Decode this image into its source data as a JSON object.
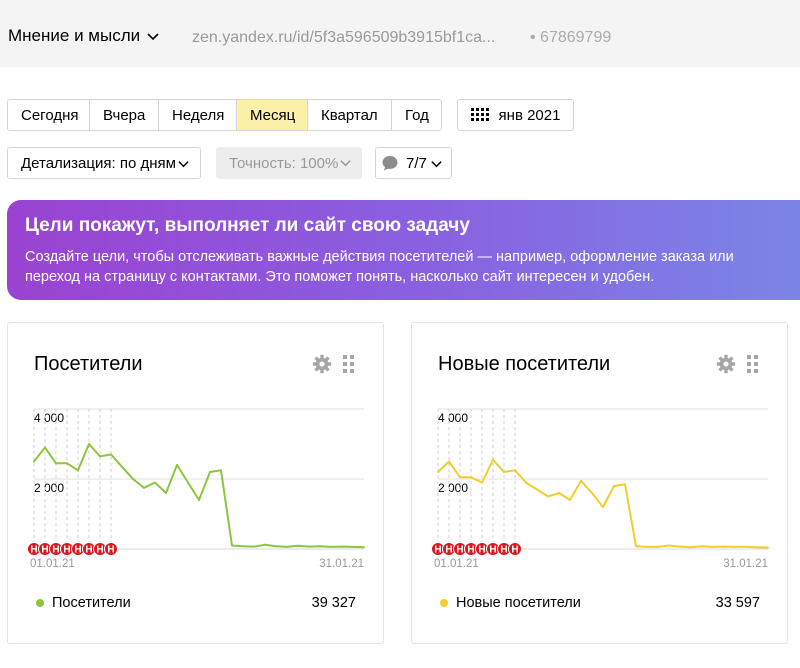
{
  "header": {
    "counter_name": "Мнение и мысли",
    "counter_url": "zen.yandex.ru/id/5f3a596509b3915bf1ca...",
    "counter_id": "• 67869799"
  },
  "periods": [
    {
      "label": "Сегодня",
      "active": false
    },
    {
      "label": "Вчера",
      "active": false
    },
    {
      "label": "Неделя",
      "active": false
    },
    {
      "label": "Месяц",
      "active": true
    },
    {
      "label": "Квартал",
      "active": false
    },
    {
      "label": "Год",
      "active": false
    }
  ],
  "datepicker": {
    "label": "янв 2021",
    "icon": "calendar-icon"
  },
  "controls": {
    "detail_label": "Детализация: по дням",
    "accuracy_label": "Точность: 100%",
    "notes_label": "7/7"
  },
  "banner": {
    "title": "Цели покажут, выполняет ли сайт свою задачу",
    "text": "Создайте цели, чтобы отслеживать важные действия посетителей — например, оформление заказа или переход на страницу с контактами. Это поможет понять, насколько сайт интересен и удобен."
  },
  "colors": {
    "active_period": "#fdf0a8",
    "banner_start": "#9a42d1",
    "banner_end": "#7a86e6",
    "visitors_series": "#8cc63f",
    "new_visitors_series": "#f2cd2e",
    "holiday_marker": "#d81820"
  },
  "widgets": [
    {
      "title": "Посетители",
      "legend_label": "Посетители",
      "total": "39 327",
      "color": "#8cc63f"
    },
    {
      "title": "Новые посетители",
      "legend_label": "Новые посетители",
      "total": "33 597",
      "color": "#f2cd2e"
    }
  ],
  "chart_data": [
    {
      "type": "line",
      "title": "Посетители",
      "x": [
        "01.01.21",
        "02.01.21",
        "03.01.21",
        "04.01.21",
        "05.01.21",
        "06.01.21",
        "07.01.21",
        "08.01.21",
        "09.01.21",
        "10.01.21",
        "11.01.21",
        "12.01.21",
        "13.01.21",
        "14.01.21",
        "15.01.21",
        "16.01.21",
        "17.01.21",
        "18.01.21",
        "19.01.21",
        "20.01.21",
        "21.01.21",
        "22.01.21",
        "23.01.21",
        "24.01.21",
        "25.01.21",
        "26.01.21",
        "27.01.21",
        "28.01.21",
        "29.01.21",
        "30.01.21",
        "31.01.21"
      ],
      "x_tick_labels": [
        "01.01.21",
        "31.01.21"
      ],
      "series": [
        {
          "name": "Посетители",
          "values": [
            2500,
            2900,
            2450,
            2450,
            2250,
            3000,
            2650,
            2700,
            2350,
            2000,
            1750,
            1900,
            1600,
            2400,
            1900,
            1400,
            2200,
            2250,
            100,
            80,
            70,
            120,
            80,
            60,
            90,
            70,
            80,
            60,
            70,
            60,
            50
          ]
        }
      ],
      "y_ticks": [
        2000,
        4000
      ],
      "y_tick_labels": [
        "2 000",
        "4 000"
      ],
      "ylim": [
        0,
        4000
      ],
      "holiday_label": "Н",
      "holidays": [
        "01.01.21",
        "02.01.21",
        "03.01.21",
        "04.01.21",
        "05.01.21",
        "06.01.21",
        "07.01.21",
        "08.01.21"
      ],
      "grid": true
    },
    {
      "type": "line",
      "title": "Новые посетители",
      "x": [
        "01.01.21",
        "02.01.21",
        "03.01.21",
        "04.01.21",
        "05.01.21",
        "06.01.21",
        "07.01.21",
        "08.01.21",
        "09.01.21",
        "10.01.21",
        "11.01.21",
        "12.01.21",
        "13.01.21",
        "14.01.21",
        "15.01.21",
        "16.01.21",
        "17.01.21",
        "18.01.21",
        "19.01.21",
        "20.01.21",
        "21.01.21",
        "22.01.21",
        "23.01.21",
        "24.01.21",
        "25.01.21",
        "26.01.21",
        "27.01.21",
        "28.01.21",
        "29.01.21",
        "30.01.21",
        "31.01.21"
      ],
      "x_tick_labels": [
        "01.01.21",
        "31.01.21"
      ],
      "series": [
        {
          "name": "Новые посетители",
          "values": [
            2200,
            2500,
            2050,
            2050,
            1900,
            2550,
            2200,
            2250,
            1900,
            1700,
            1500,
            1600,
            1400,
            1950,
            1600,
            1200,
            1800,
            1850,
            80,
            60,
            60,
            100,
            70,
            50,
            80,
            60,
            70,
            60,
            60,
            50,
            40
          ]
        }
      ],
      "y_ticks": [
        2000,
        4000
      ],
      "y_tick_labels": [
        "2 000",
        "4 000"
      ],
      "ylim": [
        0,
        4000
      ],
      "holiday_label": "Н",
      "holidays": [
        "01.01.21",
        "02.01.21",
        "03.01.21",
        "04.01.21",
        "05.01.21",
        "06.01.21",
        "07.01.21",
        "08.01.21"
      ],
      "grid": true
    }
  ]
}
